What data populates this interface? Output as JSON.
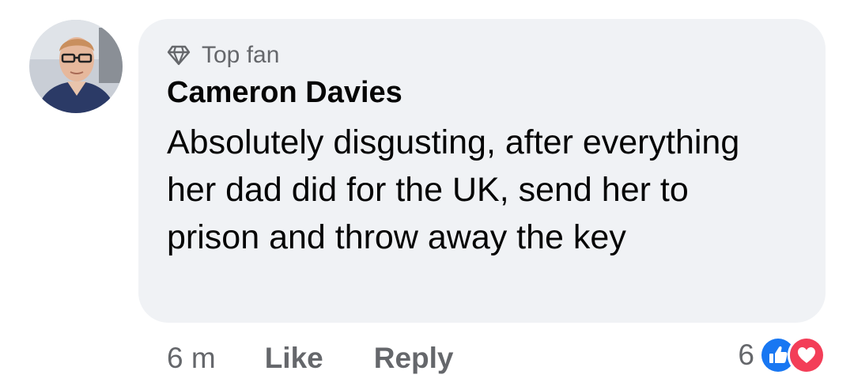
{
  "comment": {
    "badge_label": "Top fan",
    "author": "Cameron Davies",
    "text": "Absolutely disgusting, after everything her dad did for the UK, send her to prison and throw away the key",
    "time": "6 m",
    "like_label": "Like",
    "reply_label": "Reply",
    "reaction_count": "6",
    "reaction_icons": [
      "like-icon",
      "love-icon"
    ]
  },
  "colors": {
    "bubble": "#f0f2f5",
    "secondary_text": "#65676b",
    "primary_text": "#050505",
    "like_blue": "#1877f2",
    "love_red": "#f33e58"
  }
}
